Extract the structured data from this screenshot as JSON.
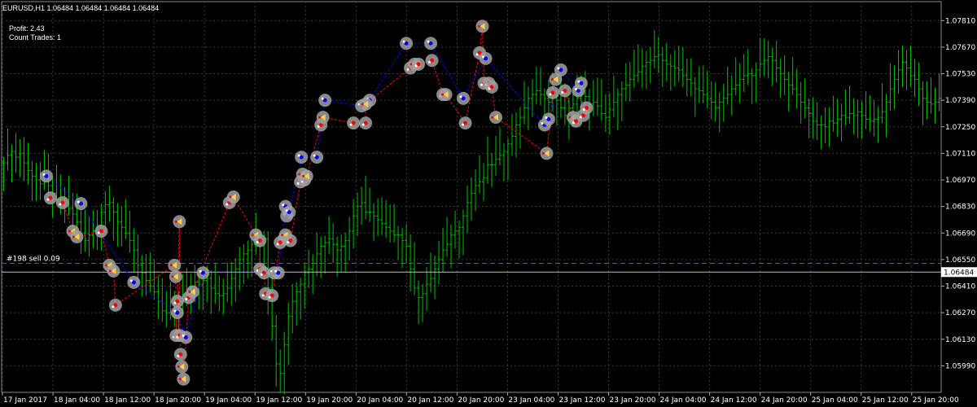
{
  "header": {
    "symbol_line": "EURUSD,H1  1.06484 1.06484 1.06484 1.06484",
    "profit": "Profit: 2.43",
    "count_trades": "Count Trades: 1"
  },
  "trade_line_label": "#198 sell 0.09",
  "current_price_label": "1.06484",
  "colors": {
    "background": "#000000",
    "grid": "#3a3a3a",
    "candle": "#00c000",
    "buy_line": "#0000ff",
    "sell_line": "#ff0000",
    "trade_line": "#00a000",
    "marker_ring": "#a0a0a0",
    "current_price_line": "#c0c0c0"
  },
  "chart_data": {
    "type": "ohlc",
    "symbol": "EURUSD",
    "timeframe": "H1",
    "ylim": [
      1.0585,
      1.0791
    ],
    "y_ticks": [
      "1.07810",
      "1.07670",
      "1.07530",
      "1.07390",
      "1.07250",
      "1.07110",
      "1.06970",
      "1.06830",
      "1.06690",
      "1.06550",
      "1.06410",
      "1.06270",
      "1.06130",
      "1.05990"
    ],
    "x_ticks": [
      "17 Jan 2017",
      "18 Jan 04:00",
      "18 Jan 12:00",
      "18 Jan 20:00",
      "19 Jan 04:00",
      "19 Jan 12:00",
      "19 Jan 20:00",
      "20 Jan 04:00",
      "20 Jan 12:00",
      "20 Jan 20:00",
      "23 Jan 04:00",
      "23 Jan 12:00",
      "23 Jan 20:00",
      "24 Jan 04:00",
      "24 Jan 12:00",
      "24 Jan 20:00",
      "25 Jan 04:00",
      "25 Jan 12:00",
      "25 Jan 20:00"
    ],
    "current_price": 1.06484,
    "trade_line_price": 1.0653,
    "closes": [
      1.0706,
      1.071,
      1.0712,
      1.0709,
      1.0711,
      1.0706,
      1.0702,
      1.0699,
      1.0697,
      1.0695,
      1.0698,
      1.0694,
      1.069,
      1.0687,
      1.0684,
      1.0685,
      1.0682,
      1.0679,
      1.0675,
      1.0669,
      1.0665,
      1.0668,
      1.067,
      1.0673,
      1.068,
      1.0684,
      1.0685,
      1.068,
      1.0675,
      1.0672,
      1.0669,
      1.0665,
      1.066,
      1.0652,
      1.0648,
      1.0644,
      1.0641,
      1.0638,
      1.0633,
      1.0628,
      1.0627,
      1.0629,
      1.063,
      1.0633,
      1.0636,
      1.0638,
      1.0641,
      1.0643,
      1.0642,
      1.0644,
      1.0645,
      1.064,
      1.0637,
      1.0636,
      1.0637,
      1.064,
      1.0645,
      1.065,
      1.0655,
      1.0658,
      1.066,
      1.0663,
      1.0667,
      1.0666,
      1.0666,
      1.064,
      1.062,
      1.06,
      1.0595,
      1.061,
      1.0625,
      1.0633,
      1.0638,
      1.0642,
      1.0648,
      1.065,
      1.0653,
      1.0658,
      1.0662,
      1.0664,
      1.0666,
      1.0663,
      1.066,
      1.0662,
      1.0665,
      1.067,
      1.0678,
      1.0683,
      1.0685,
      1.068,
      1.068,
      1.0678,
      1.0676,
      1.0674,
      1.0672,
      1.067,
      1.0668,
      1.0668,
      1.0665,
      1.0662,
      1.065,
      1.064,
      1.0635,
      1.0637,
      1.0642,
      1.0645,
      1.065,
      1.0655,
      1.066,
      1.0663,
      1.0668,
      1.067,
      1.0672,
      1.0678,
      1.0685,
      1.069,
      1.0694,
      1.0696,
      1.0698,
      1.0705,
      1.0705,
      1.0708,
      1.071,
      1.0712,
      1.0716,
      1.072,
      1.0726,
      1.073,
      1.0735,
      1.074,
      1.0742,
      1.0744,
      1.0742,
      1.074,
      1.0738,
      1.0741,
      1.0739,
      1.0735,
      1.0731,
      1.0735,
      1.0737,
      1.074,
      1.0738,
      1.0741,
      1.0737,
      1.0738,
      1.0736,
      1.0732,
      1.073,
      1.0734,
      1.0738,
      1.0742,
      1.0745,
      1.0747,
      1.075,
      1.0752,
      1.0754,
      1.0757,
      1.0759,
      1.076,
      1.0762,
      1.0763,
      1.076,
      1.0758,
      1.0757,
      1.0756,
      1.0755,
      1.0752,
      1.075,
      1.0748,
      1.0745,
      1.0744,
      1.0742,
      1.074,
      1.0738,
      1.0735,
      1.0738,
      1.074,
      1.0742,
      1.0745,
      1.0747,
      1.075,
      1.0752,
      1.0753,
      1.0752,
      1.0755,
      1.0758,
      1.076,
      1.0762,
      1.076,
      1.0756,
      1.0753,
      1.075,
      1.0747,
      1.0745,
      1.0742,
      1.0738,
      1.0735,
      1.0732,
      1.0728,
      1.0726,
      1.0726,
      1.0725,
      1.0728,
      1.0727,
      1.0729,
      1.0731,
      1.073,
      1.0732,
      1.0731,
      1.0733,
      1.0731,
      1.0729,
      1.0728,
      1.0729,
      1.073,
      1.0733,
      1.0738,
      1.0745,
      1.075,
      1.0755,
      1.0759,
      1.0756,
      1.0752,
      1.075,
      1.0745,
      1.074,
      1.0738,
      1.0737,
      1.0738,
      1.074
    ]
  },
  "markers": [
    {
      "time": 10.5,
      "price": 1.0699,
      "kind": "buy"
    },
    {
      "time": 11.5,
      "price": 1.06875,
      "kind": "sell"
    },
    {
      "time": 14.5,
      "price": 1.0685,
      "kind": "sell"
    },
    {
      "time": 19,
      "price": 1.06845,
      "kind": "buy"
    },
    {
      "time": 17,
      "price": 1.067,
      "kind": "sell-close"
    },
    {
      "time": 18,
      "price": 1.0667,
      "kind": "sell-close"
    },
    {
      "time": 24,
      "price": 1.067,
      "kind": "sell"
    },
    {
      "time": 26,
      "price": 1.0652,
      "kind": "sell-close"
    },
    {
      "time": 27,
      "price": 1.0649,
      "kind": "sell-close"
    },
    {
      "time": 27.5,
      "price": 1.0631,
      "kind": "sell"
    },
    {
      "time": 32,
      "price": 1.0643,
      "kind": "buy"
    },
    {
      "time": 42,
      "price": 1.0652,
      "kind": "sell-close"
    },
    {
      "time": 42.3,
      "price": 1.0646,
      "kind": "sell-close"
    },
    {
      "time": 42.7,
      "price": 1.0633,
      "kind": "sell"
    },
    {
      "time": 42.7,
      "price": 1.0627,
      "kind": "buy"
    },
    {
      "time": 42.4,
      "price": 1.0615,
      "kind": "sell"
    },
    {
      "time": 43.3,
      "price": 1.0615,
      "kind": "sell"
    },
    {
      "time": 44.8,
      "price": 1.0614,
      "kind": "buy"
    },
    {
      "time": 43.5,
      "price": 1.0605,
      "kind": "sell"
    },
    {
      "time": 43.8,
      "price": 1.05985,
      "kind": "sell-close"
    },
    {
      "time": 44.2,
      "price": 1.0592,
      "kind": "sell-close"
    },
    {
      "time": 45.5,
      "price": 1.0635,
      "kind": "sell"
    },
    {
      "time": 46.5,
      "price": 1.0638,
      "kind": "sell-close"
    },
    {
      "time": 43.2,
      "price": 1.0675,
      "kind": "sell-close"
    },
    {
      "time": 49,
      "price": 1.0648,
      "kind": "buy"
    },
    {
      "time": 55.5,
      "price": 1.0685,
      "kind": "sell"
    },
    {
      "time": 56.5,
      "price": 1.0688,
      "kind": "sell-close"
    },
    {
      "time": 62,
      "price": 1.0668,
      "kind": "sell-close"
    },
    {
      "time": 63,
      "price": 1.0665,
      "kind": "sell"
    },
    {
      "time": 63,
      "price": 1.065,
      "kind": "sell"
    },
    {
      "time": 64,
      "price": 1.0648,
      "kind": "sell"
    },
    {
      "time": 64.4,
      "price": 1.0637,
      "kind": "sell"
    },
    {
      "time": 66,
      "price": 1.0636,
      "kind": "sell"
    },
    {
      "time": 66.5,
      "price": 1.0648,
      "kind": "buy"
    },
    {
      "time": 67.5,
      "price": 1.0648,
      "kind": "buy"
    },
    {
      "time": 69,
      "price": 1.0666,
      "kind": "sell"
    },
    {
      "time": 68,
      "price": 1.0664,
      "kind": "sell"
    },
    {
      "time": 69.3,
      "price": 1.0668,
      "kind": "sell-close"
    },
    {
      "time": 70.5,
      "price": 1.0665,
      "kind": "sell"
    },
    {
      "time": 69.3,
      "price": 1.0683,
      "kind": "buy"
    },
    {
      "time": 69.6,
      "price": 1.0678,
      "kind": "buy"
    },
    {
      "time": 70.2,
      "price": 1.068,
      "kind": "buy"
    },
    {
      "time": 73,
      "price": 1.0696,
      "kind": "sell"
    },
    {
      "time": 74,
      "price": 1.0697,
      "kind": "sell"
    },
    {
      "time": 73.5,
      "price": 1.07,
      "kind": "sell-close"
    },
    {
      "time": 74.5,
      "price": 1.0699,
      "kind": "sell-close"
    },
    {
      "time": 73.2,
      "price": 1.0709,
      "kind": "buy"
    },
    {
      "time": 77,
      "price": 1.0709,
      "kind": "buy"
    },
    {
      "time": 78,
      "price": 1.0726,
      "kind": "sell"
    },
    {
      "time": 78.5,
      "price": 1.073,
      "kind": "sell-close"
    },
    {
      "time": 79,
      "price": 1.0739,
      "kind": "buy"
    },
    {
      "time": 86,
      "price": 1.0727,
      "kind": "sell"
    },
    {
      "time": 88,
      "price": 1.0736,
      "kind": "buy"
    },
    {
      "time": 89,
      "price": 1.0727,
      "kind": "sell"
    },
    {
      "time": 90,
      "price": 1.0739,
      "kind": "buy"
    },
    {
      "time": 89,
      "price": 1.0737,
      "kind": "sell-close"
    },
    {
      "time": 99,
      "price": 1.0769,
      "kind": "buy"
    },
    {
      "time": 100,
      "price": 1.0756,
      "kind": "sell"
    },
    {
      "time": 101,
      "price": 1.0758,
      "kind": "sell-close"
    },
    {
      "time": 102,
      "price": 1.0758,
      "kind": "sell"
    },
    {
      "time": 105,
      "price": 1.0769,
      "kind": "buy"
    },
    {
      "time": 105.3,
      "price": 1.076,
      "kind": "sell"
    },
    {
      "time": 108,
      "price": 1.0742,
      "kind": "sell"
    },
    {
      "time": 108.7,
      "price": 1.0742,
      "kind": "sell-close"
    },
    {
      "time": 113,
      "price": 1.074,
      "kind": "buy"
    },
    {
      "time": 113.5,
      "price": 1.0727,
      "kind": "sell"
    },
    {
      "time": 117,
      "price": 1.0764,
      "kind": "sell"
    },
    {
      "time": 117.7,
      "price": 1.0778,
      "kind": "sell-close"
    },
    {
      "time": 118.5,
      "price": 1.0761,
      "kind": "buy"
    },
    {
      "time": 118.1,
      "price": 1.0748,
      "kind": "sell"
    },
    {
      "time": 119.3,
      "price": 1.0748,
      "kind": "sell"
    },
    {
      "time": 120,
      "price": 1.0746,
      "kind": "sell"
    },
    {
      "time": 121,
      "price": 1.073,
      "kind": "sell-close"
    },
    {
      "time": 133,
      "price": 1.0726,
      "kind": "buy"
    },
    {
      "time": 134,
      "price": 1.0729,
      "kind": "buy"
    },
    {
      "time": 133.5,
      "price": 1.0711,
      "kind": "sell-close"
    },
    {
      "time": 135,
      "price": 1.0743,
      "kind": "sell"
    },
    {
      "time": 135.7,
      "price": 1.075,
      "kind": "sell-close"
    },
    {
      "time": 137,
      "price": 1.0755,
      "kind": "buy"
    },
    {
      "time": 138,
      "price": 1.0744,
      "kind": "sell"
    },
    {
      "time": 140,
      "price": 1.073,
      "kind": "sell-close"
    },
    {
      "time": 140.7,
      "price": 1.0728,
      "kind": "sell"
    },
    {
      "time": 141.3,
      "price": 1.0744,
      "kind": "buy"
    },
    {
      "time": 142,
      "price": 1.0748,
      "kind": "buy"
    },
    {
      "time": 142.5,
      "price": 1.0731,
      "kind": "sell"
    },
    {
      "time": 143.3,
      "price": 1.0735,
      "kind": "sell"
    }
  ]
}
